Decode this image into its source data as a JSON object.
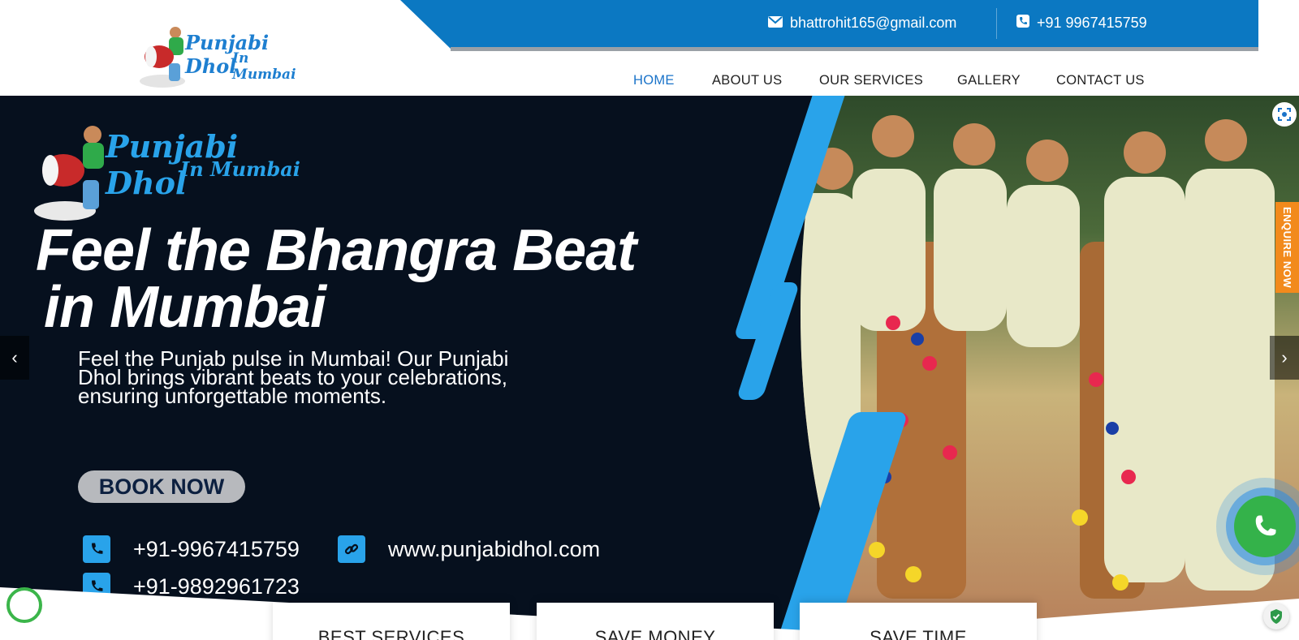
{
  "header": {
    "email": "bhattrohit165@gmail.com",
    "phone": "+91 9967415759",
    "logo": {
      "line1": "Punjabi Dhol",
      "line2": "In Mumbai"
    },
    "nav": [
      "HOME",
      "ABOUT US",
      "OUR SERVICES",
      "GALLERY",
      "CONTACT US"
    ],
    "active_nav": "HOME"
  },
  "hero": {
    "logo": {
      "line1": "Punjabi Dhol",
      "line2": "In Mumbai"
    },
    "headline_line1": "Feel the Bhangra Beat",
    "headline_line2": "in Mumbai",
    "subtext": "Feel the Punjab pulse in Mumbai! Our Punjabi Dhol brings vibrant beats to your celebrations, ensuring unforgettable moments.",
    "book_button": "BOOK NOW",
    "phone1": "+91-9967415759",
    "phone2": "+91-9892961723",
    "website": "www.punjabidhol.com"
  },
  "enquire_tab": "ENQUIRE NOW",
  "features": [
    "BEST SERVICES",
    "SAVE MONEY",
    "SAVE TIME"
  ],
  "colors": {
    "brand_blue": "#0b78c2",
    "accent_blue": "#29a3ea",
    "hero_bg": "#06101e",
    "enquire_orange": "#f28a1c",
    "call_green": "#34b24a"
  }
}
